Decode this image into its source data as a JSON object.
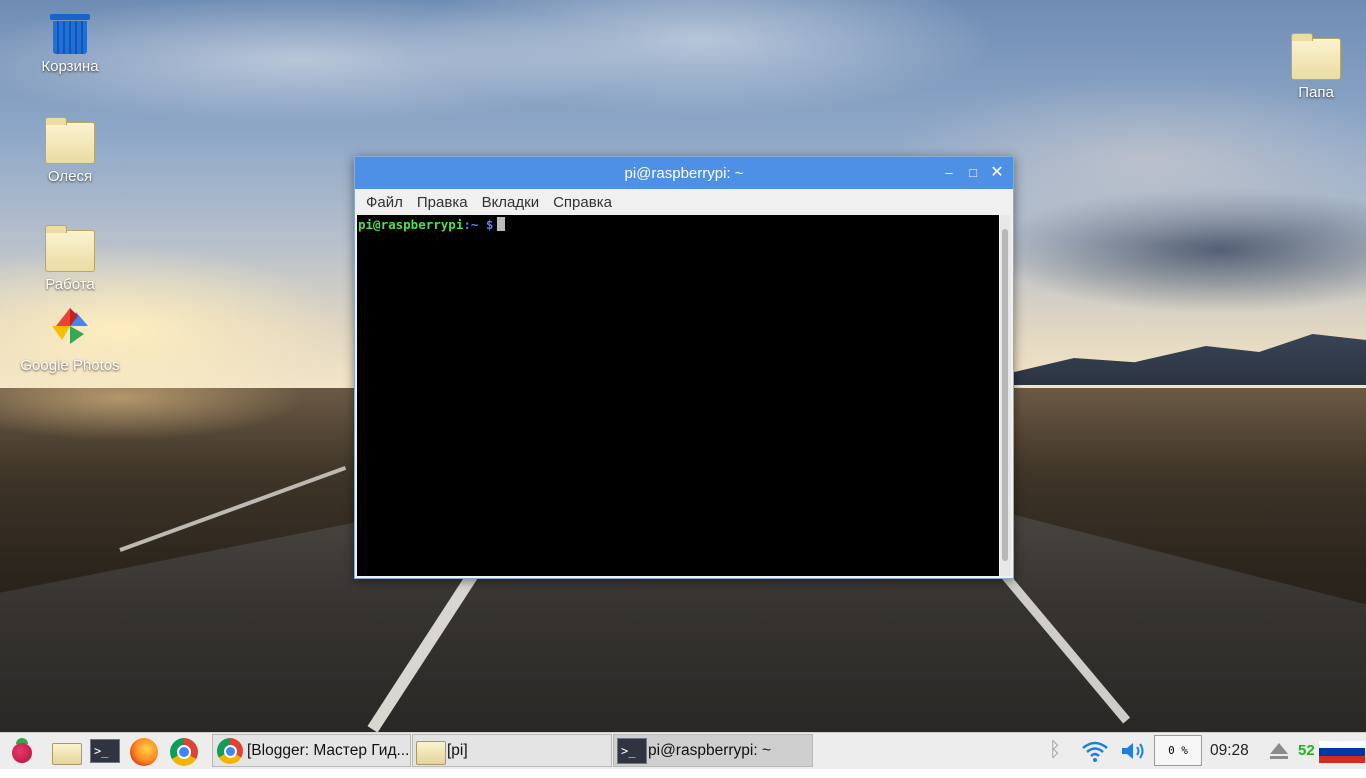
{
  "desktop": {
    "icons": [
      {
        "label": "Корзина",
        "icon": "trash-icon"
      },
      {
        "label": "Олеся",
        "icon": "folder-icon"
      },
      {
        "label": "Работа",
        "icon": "folder-icon"
      },
      {
        "label": "Google Photos",
        "icon": "google-photos-icon"
      },
      {
        "label": "Папа",
        "icon": "folder-icon"
      }
    ]
  },
  "terminal": {
    "title": "pi@raspberrypi: ~",
    "window_buttons": {
      "minimize": "‒",
      "maximize": "□",
      "close": "✕"
    },
    "menu": [
      "Файл",
      "Правка",
      "Вкладки",
      "Справка"
    ],
    "prompt_user": "pi@raspberrypi",
    "prompt_path": ":~ $",
    "colors": {
      "titlebar": "#4d90e6",
      "prompt_user": "#4fe04f",
      "prompt_path": "#5d7cff",
      "background": "#000000"
    }
  },
  "taskbar": {
    "launchers": [
      "raspberry-menu-icon",
      "file-manager-icon",
      "terminal-icon",
      "firefox-icon",
      "chromium-icon"
    ],
    "terminal_glyph": ">_",
    "tasks": [
      {
        "label": "[Blogger: Мастер Гид...",
        "icon": "chromium-icon"
      },
      {
        "label": "[pi]",
        "icon": "folder-icon"
      },
      {
        "label": "pi@raspberrypi: ~",
        "icon": "terminal-icon"
      }
    ],
    "tray": {
      "cpu": "0 %",
      "clock": "09:28",
      "keyboard_indicator": "52",
      "icons": [
        "bluetooth-icon",
        "wifi-icon",
        "volume-icon",
        "eject-icon",
        "russian-flag-icon"
      ]
    }
  }
}
